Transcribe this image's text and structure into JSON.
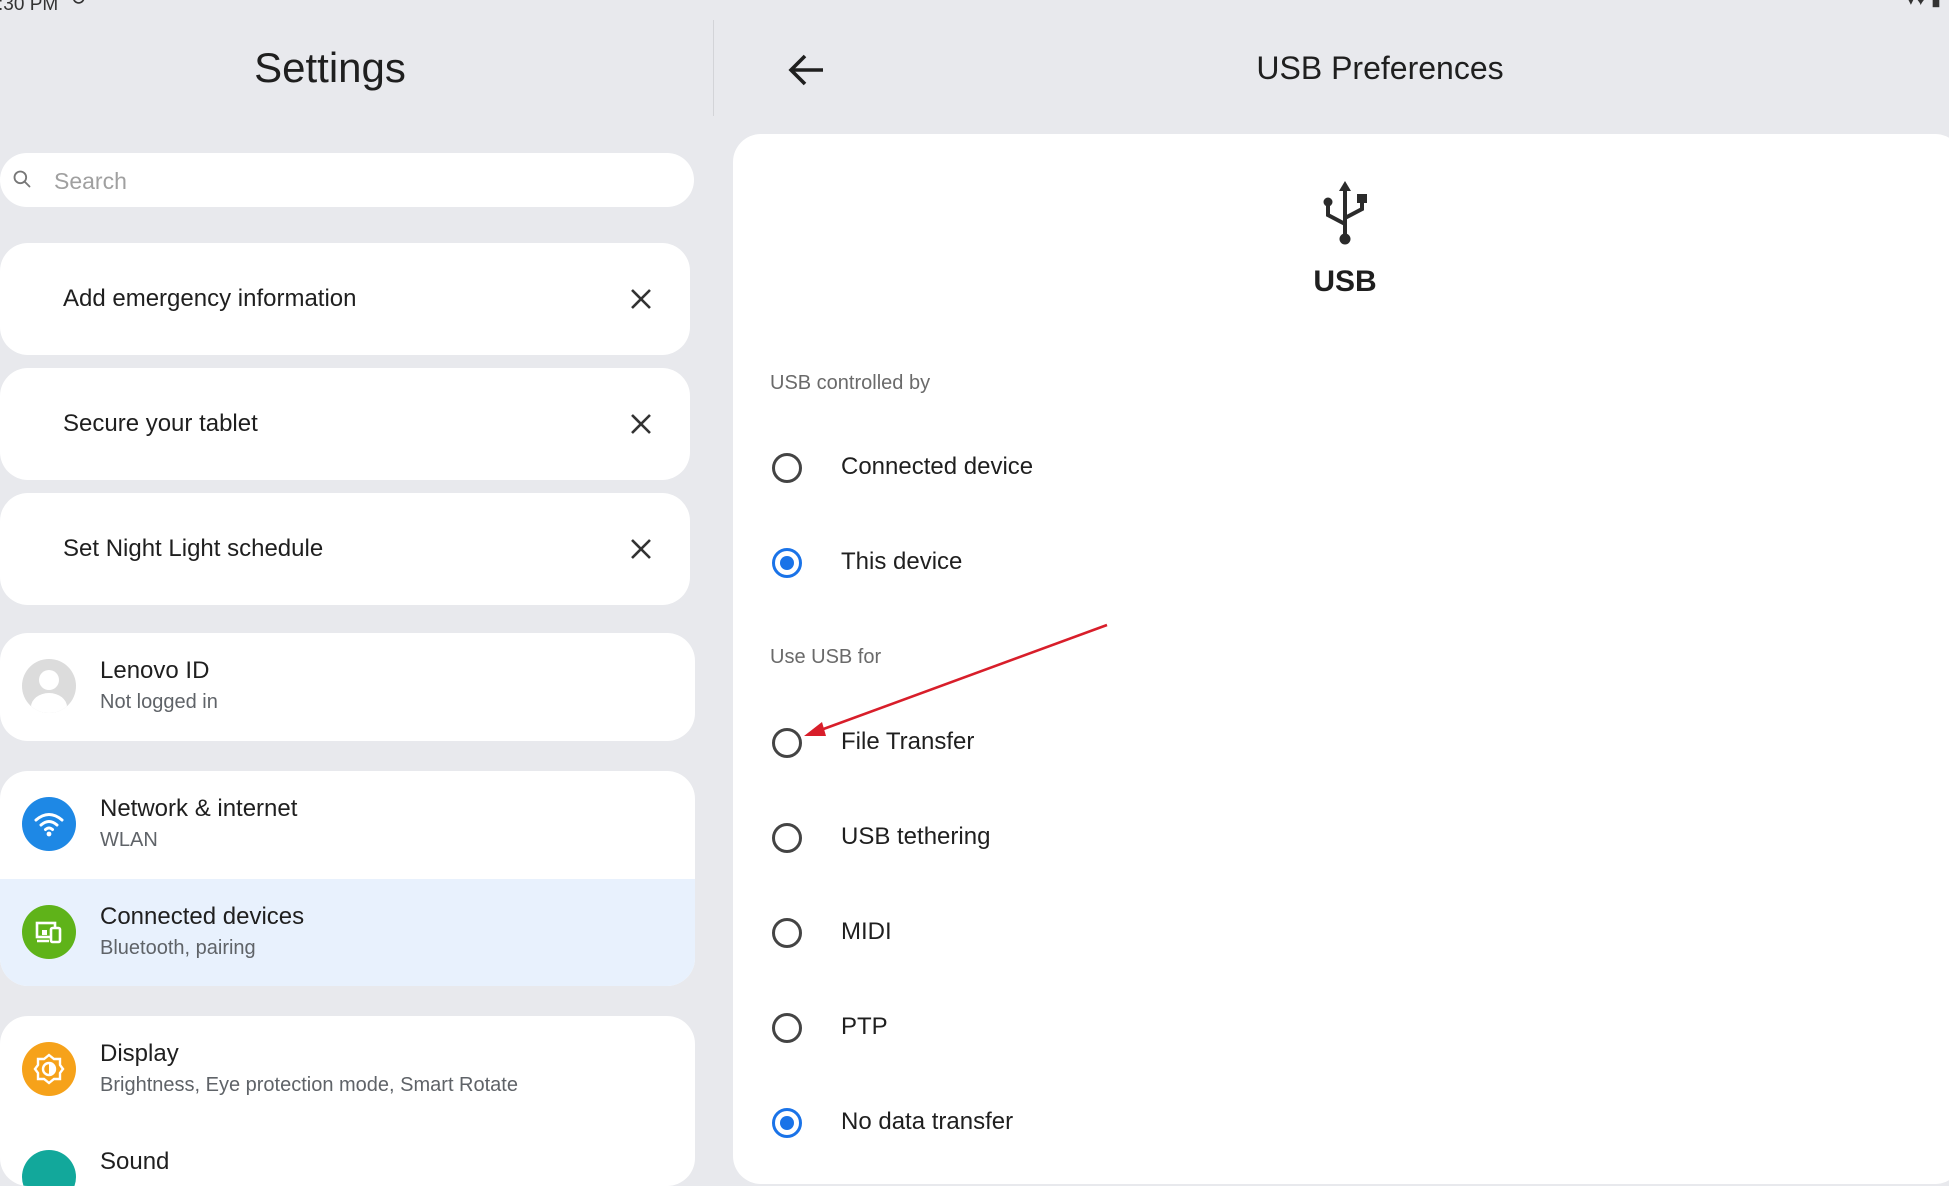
{
  "status_bar": {
    "time": ":30 PM"
  },
  "left": {
    "title": "Settings",
    "search": {
      "placeholder": "Search"
    },
    "suggestions": [
      {
        "label": "Add emergency information"
      },
      {
        "label": "Secure your tablet"
      },
      {
        "label": "Set Night Light schedule"
      }
    ],
    "account": {
      "title": "Lenovo ID",
      "subtitle": "Not logged in"
    },
    "items": [
      {
        "title": "Network & internet",
        "subtitle": "WLAN",
        "icon": "wifi-icon",
        "color": "#1e88e5"
      },
      {
        "title": "Connected devices",
        "subtitle": "Bluetooth, pairing",
        "icon": "connected-devices-icon",
        "color": "#5fb319"
      },
      {
        "title": "Display",
        "subtitle": "Brightness, Eye protection mode, Smart Rotate",
        "icon": "brightness-icon",
        "color": "#f6a21a"
      },
      {
        "title": "Sound",
        "subtitle": "",
        "icon": "sound-icon",
        "color": "#12a89b"
      }
    ],
    "selected_highlight_color": "#e8f1fd"
  },
  "right": {
    "title": "USB Preferences",
    "usb_label": "USB",
    "controlled_by": {
      "header": "USB controlled by",
      "options": [
        {
          "label": "Connected device",
          "checked": false
        },
        {
          "label": "This device",
          "checked": true
        }
      ]
    },
    "use_for": {
      "header": "Use USB for",
      "options": [
        {
          "label": "File Transfer",
          "checked": false
        },
        {
          "label": "USB tethering",
          "checked": false
        },
        {
          "label": "MIDI",
          "checked": false
        },
        {
          "label": "PTP",
          "checked": false
        },
        {
          "label": "No data transfer",
          "checked": true
        }
      ]
    },
    "accent_color": "#1a73e8",
    "annotation_color": "#d81e2a"
  }
}
